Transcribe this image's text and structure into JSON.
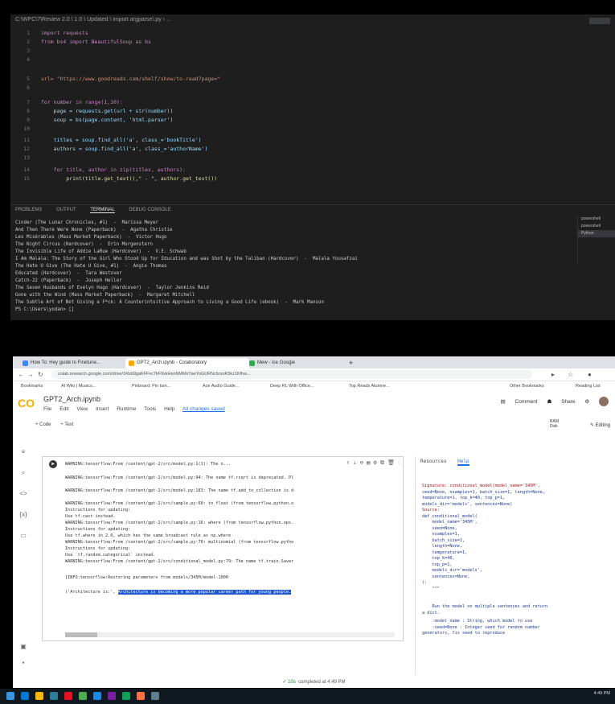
{
  "vscode": {
    "title": "C:\\WPC\\7\\Review 2.0 \\ 1.0 \\ Updated \\ import argparse\\.py › ...",
    "minimap_label": "Python",
    "code": [
      {
        "num": "1",
        "text": "import requests"
      },
      {
        "num": "2",
        "text": "from bs4 import BeautifulSoup as bs"
      },
      {
        "num": "3",
        "text": ""
      },
      {
        "num": "4",
        "text": ""
      },
      {
        "num": "5",
        "text": "url= \"https://www.goodreads.com/shelf/show/to-read?page=\""
      },
      {
        "num": "6",
        "text": ""
      },
      {
        "num": "7",
        "text": "for number in range(1,10):"
      },
      {
        "num": "8",
        "text": "    page = requests.get(url + str(number))"
      },
      {
        "num": "9",
        "text": "    soup = bs(page.content, 'html.parser')"
      },
      {
        "num": "10",
        "text": ""
      },
      {
        "num": "11",
        "text": "    titles = soup.find_all('a', class_='bookTitle')"
      },
      {
        "num": "12",
        "text": "    authors = soup.find_all('a', class_='authorName')"
      },
      {
        "num": "13",
        "text": ""
      },
      {
        "num": "14",
        "text": "    for title, author in zip(titles, authors):"
      },
      {
        "num": "15",
        "text": "        print(title.get_text(),\" - \", author.get_text())"
      }
    ],
    "panel_tabs": [
      "PROBLEMS",
      "OUTPUT",
      "TERMINAL",
      "DEBUG CONSOLE"
    ],
    "terminal": [
      "Cinder (The Lunar Chronicles, #1)  -  Marissa Meyer",
      "And Then There Were None (Paperback)  -  Agatha Christie",
      "Les Misérables (Mass Market Paperback)  -  Victor Hugo",
      "The Night Circus (Hardcover)  -  Erin Morgenstern",
      "The Invisible Life of Addie LaRue (Hardcover)  -  V.E. Schwab",
      "I Am Malala: The Story of the Girl Who Stood Up for Education and was Shot by the Taliban (Hardcover)  -  Malala Yousafzai",
      "The Hate U Give (The Hate U Give, #1)  -  Angie Thomas",
      "Educated (Hardcover)  -  Tara Westover",
      "Catch-22 (Paperback)  -  Joseph Heller",
      "The Seven Husbands of Evelyn Hugo (Hardcover)  -  Taylor Jenkins Reid",
      "Gone with the Wind (Mass Market Paperback)  -  Margaret Mitchell",
      "The Subtle Art of Not Giving a F*ck: A Counterintuitive Approach to Living a Good Life (ebook)  -  Mark Manson",
      "PS C:\\Users\\yodan> []"
    ],
    "terminal_list": [
      "powershell",
      "powershell",
      "Python"
    ]
  },
  "chrome": {
    "tabs": [
      "How To: Hey guide to Finetune...",
      "GPT2_Arch.ipynb - Colaboratory",
      "Mew - Ice Google"
    ],
    "url": "colab.research.google.com/drive/1Rsb9gaKFFvc7kF9xkHsnNMMxYaeYoGURNcbrsoK5kz1Kfhw...",
    "bookmarks": [
      "Bookmarks",
      "AI Wiki | Musics...",
      "Pinboard: Pin tum...",
      "Ace Audio Guide...",
      "Deep RL With Office...",
      "Top Reads Alumne...",
      "Other Bookmarks",
      "Reading List"
    ]
  },
  "colab": {
    "logo": "CO",
    "title": "GPT2_Arch.ipynb",
    "menu": [
      "File",
      "Edit",
      "View",
      "Insert",
      "Runtime",
      "Tools",
      "Help"
    ],
    "saved_status": "All changes saved",
    "comment": "Comment",
    "share": "Share",
    "add_code": "+ Code",
    "add_text": "+ Text",
    "ram_label": "RAM",
    "disk_label": "Disk",
    "editing": "Editing",
    "output": [
      "WARNING:tensorflow:From /content/gpt-2/src/model.py:1(1): The n...",
      "WARNING:tensorflow:From /content/gpt-2/src/model.py:94: The name tf.rsqrt is deprecated. Pl",
      "",
      "WARNING:tensorflow:From /content/gpt-2/src/model.py:183: The name tf.add_to_collection is d",
      "",
      "WARNING:tensorflow:From /content/gpt-2/src/sample.py:60: to_float (from tensorflow.python.o",
      "Instructions for updating:",
      "Use tf.cast instead.",
      "WARNING:tensorflow:From /content/gpt-2/src/sample.py:16: where (from tensorflow.python.ops.",
      "Instructions for updating:",
      "Use tf.where in 2.0, which has the same broadcast rule as np.where",
      "WARNING:tensorflow:From /content/gpt-2/src/sample.py:70: multinomial (from tensorflow.pytho",
      "Instructions for updating:",
      "Use `tf.random.categorical` instead.",
      "WARNING:tensorflow:From /content/gpt-2/src/conditional_model.py:79: The name tf.train.Saver",
      "",
      "[INFO:tensorflow:Restoring parameters from models/345M/model-1000",
      "",
      "('Architecture is:', "
    ],
    "highlighted": "Architecture is becoming a more popular career path for young people.",
    "help_tabs": [
      "Resources",
      "Help"
    ],
    "help_lines": [
      "Signature: conditional_model(model_name='345M',",
      "seed=None, nsamples=1, batch_size=1, length=None,",
      "temperature=1, top_k=40, top_p=1,",
      "models_dir='models', sentences=None)",
      "Source:",
      "def conditional_model(",
      "    model_name='345M',",
      "    seed=None,",
      "    nsamples=1,",
      "    batch_size=1,",
      "    length=None,",
      "    temperature=1,",
      "    top_k=40,",
      "    top_p=1,",
      "    models_dir='models',",
      "    sentences=None,",
      "):",
      "    \"\"\"",
      "",
      "    Run the model on multiple sentences and return",
      "a dict.",
      "    :model_name : String, which model to use",
      "    :seed=None : Integer seed for random number",
      "generators, fix seed to reproduce"
    ],
    "status": "completed at 4:49 PM",
    "status_check": "✓ 10s"
  },
  "taskbar": {
    "time": "4:49 PM",
    "colors": [
      "#0078d4",
      "#ffb900",
      "#2d7d9a",
      "#e81123",
      "#4caf50",
      "#1e88e5",
      "#7b1fa2",
      "#0f9d58",
      "#ff7043",
      "#607d8b"
    ]
  }
}
